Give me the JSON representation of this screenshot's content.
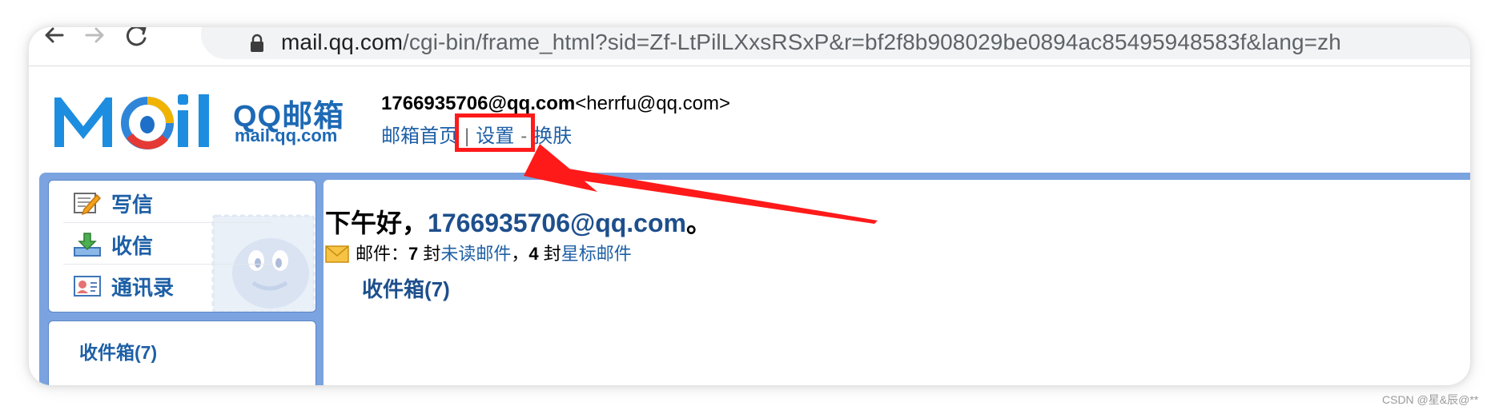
{
  "browser": {
    "url_host": "mail.qq.com",
    "url_path": "/cgi-bin/frame_html?sid=Zf-LtPilLXxsRSxP&r=bf2f8b908029be0894ac85495948583f&lang=zh"
  },
  "brand": {
    "logo_text": "MOil",
    "title": "QQ邮箱",
    "domain": "mail.qq.com"
  },
  "account": {
    "address": "1766935706@qq.com",
    "alias": "<herrfu@qq.com>"
  },
  "header_links": {
    "home": "邮箱首页",
    "sep1": "|",
    "settings": "设置",
    "sep2": "-",
    "skin": "换肤"
  },
  "sidebar": {
    "items": [
      {
        "label": "写信",
        "icon": "compose-icon"
      },
      {
        "label": "收信",
        "icon": "receive-icon"
      },
      {
        "label": "通讯录",
        "icon": "contacts-icon"
      }
    ],
    "folder": "收件箱(7)"
  },
  "main": {
    "greeting_prefix": "下午好，",
    "greeting_email": "1766935706@qq.com",
    "greeting_suffix": "。",
    "stats_prefix": "邮件：",
    "unread_count": "7",
    "unread_unit": " 封",
    "unread_label": "未读邮件",
    "stats_comma": "，",
    "starred_count": "4",
    "starred_unit": " 封",
    "starred_label": "星标邮件",
    "inbox_link": "收件箱(7)"
  },
  "watermark": "CSDN @星&辰@**",
  "colors": {
    "link": "#1d5fa6",
    "frame_blue": "#7aa3e0",
    "annotation_red": "#ff1a1a"
  }
}
